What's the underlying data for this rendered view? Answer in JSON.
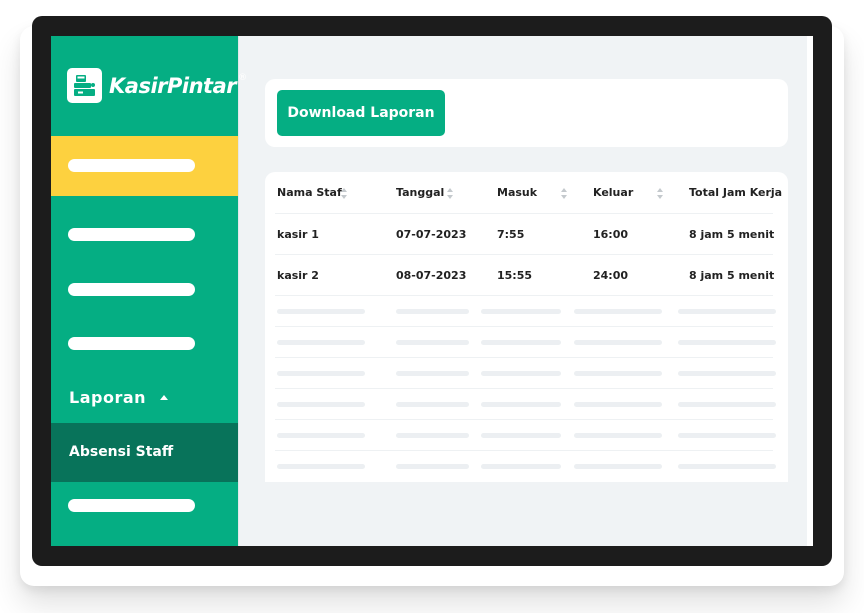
{
  "app": {
    "logo_text": "KasirPintar",
    "logo_reg": "®"
  },
  "sidebar": {
    "section_label": "Laporan",
    "active_subitem": "Absensi Staff"
  },
  "toolbar": {
    "download_label": "Download Laporan"
  },
  "table": {
    "headers": [
      "Nama Staf",
      "Tanggal",
      "Masuk",
      "Keluar",
      "Total Jam Kerja"
    ],
    "rows": [
      [
        "kasir 1",
        "07-07-2023",
        "7:55",
        "16:00",
        "8 jam 5 menit"
      ],
      [
        "kasir 2",
        "08-07-2023",
        "15:55",
        "24:00",
        "8 jam 5 menit"
      ]
    ]
  },
  "colors": {
    "primary_green": "#05ae83",
    "dark_green": "#08735a",
    "active_yellow": "#fdd13f"
  }
}
